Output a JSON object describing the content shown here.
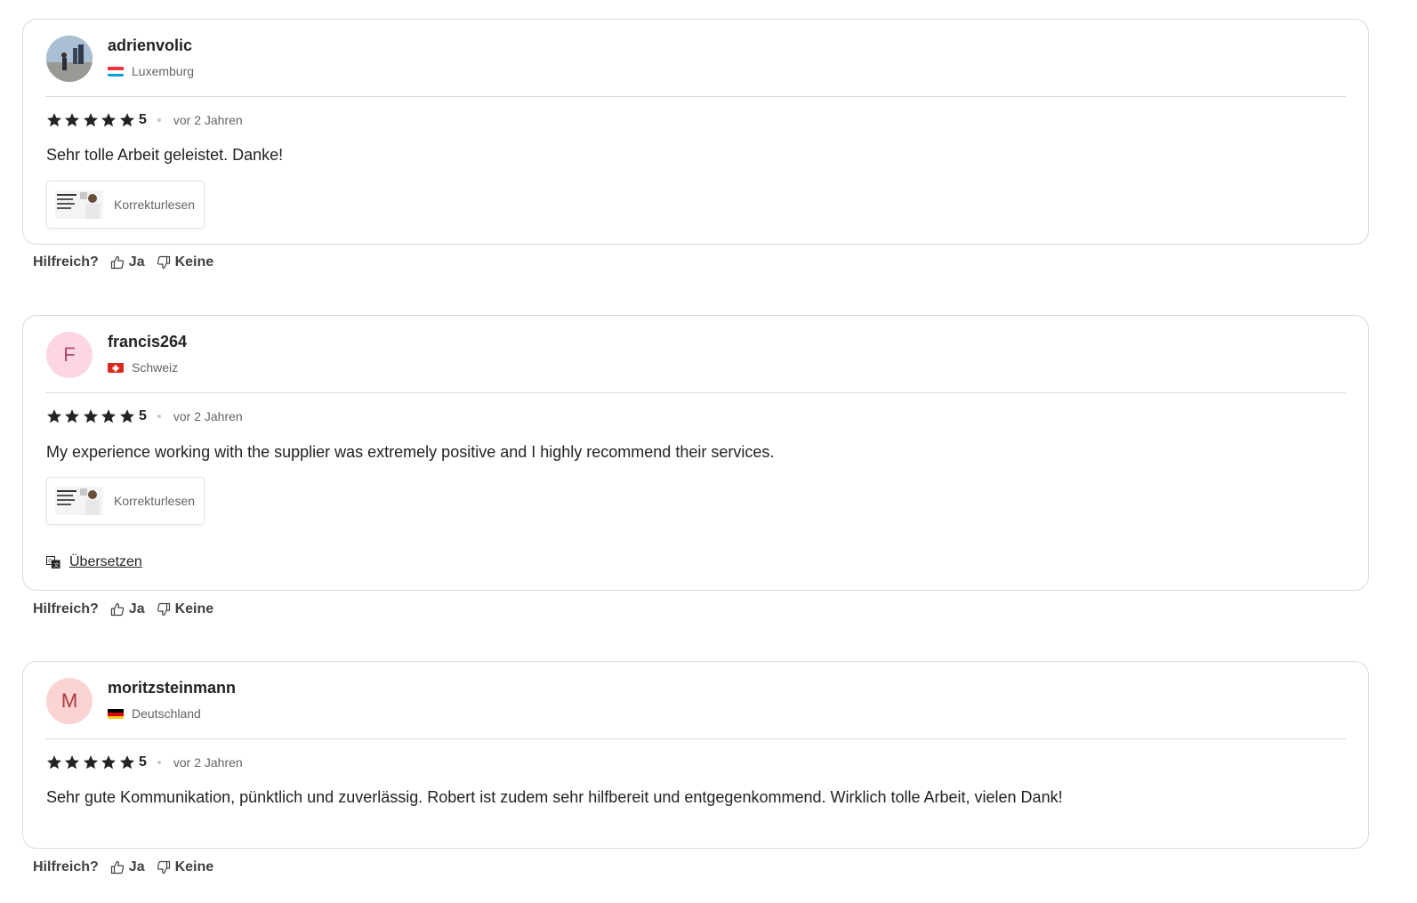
{
  "reviews": [
    {
      "username": "adrienvolic",
      "country": "Luxemburg",
      "flag": "luxembourg",
      "avatar": "photo",
      "rating": "5",
      "time": "vor 2 Jahren",
      "text": "Sehr tolle Arbeit geleistet. Danke!",
      "tag": "Korrekturlesen",
      "translate": null,
      "helpful": {
        "question": "Hilfreich?",
        "yes": "Ja",
        "no": "Keine"
      }
    },
    {
      "username": "francis264",
      "country": "Schweiz",
      "flag": "switzerland",
      "avatar_letter": "F",
      "avatar_bg": "#fcd6e4",
      "avatar_fg": "#b04a6e",
      "rating": "5",
      "time": "vor 2 Jahren",
      "text": "My experience working with the supplier was extremely positive and I highly recommend their services.",
      "tag": "Korrekturlesen",
      "translate": "Übersetzen",
      "helpful": {
        "question": "Hilfreich?",
        "yes": "Ja",
        "no": "Keine"
      }
    },
    {
      "username": "moritzsteinmann",
      "country": "Deutschland",
      "flag": "germany",
      "avatar_letter": "M",
      "avatar_bg": "#fbd3d3",
      "avatar_fg": "#a83a3a",
      "rating": "5",
      "time": "vor 2 Jahren",
      "text": "Sehr gute Kommunikation, pünktlich und zuverlässig. Robert ist zudem sehr hilfbereit und entgegenkommend. Wirklich tolle Arbeit, vielen Dank!",
      "tag": null,
      "translate": null,
      "helpful": {
        "question": "Hilfreich?",
        "yes": "Ja",
        "no": "Keine"
      }
    }
  ],
  "colors": {
    "text": "#222325",
    "muted": "#62646a",
    "border": "#dadbdd",
    "star": "#222325"
  },
  "icons": [
    "star-icon",
    "thumbs-up-icon",
    "thumbs-down-icon",
    "translate-icon",
    "flag-icon"
  ]
}
